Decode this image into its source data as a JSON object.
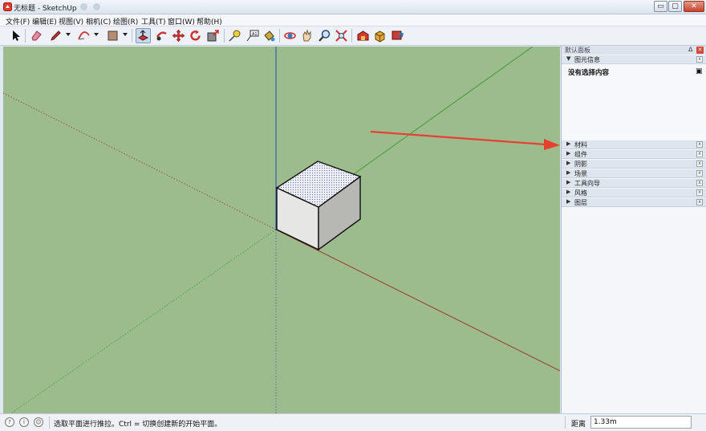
{
  "window": {
    "title": "无标题 - SketchUp",
    "minimize_glyph": "▭",
    "maximize_glyph": "▢",
    "close_glyph": "✕"
  },
  "menu": [
    "文件(F)",
    "编辑(E)",
    "视图(V)",
    "相机(C)",
    "绘图(R)",
    "工具(T)",
    "窗口(W)",
    "帮助(H)"
  ],
  "toolbar": {
    "tools": [
      "select-icon",
      "eraser-icon",
      "pencil-icon",
      "arc-icon",
      "rectangle-icon",
      "push-pull-icon",
      "follow-me-icon",
      "move-icon",
      "rotate-icon",
      "scale-icon",
      "tape-measure-icon",
      "text-icon",
      "paint-bucket-icon",
      "orbit-icon",
      "pan-icon",
      "zoom-icon",
      "zoom-extents-icon",
      "warehouse-icon",
      "components-icon",
      "share-icon"
    ],
    "active_tool": "push-pull-icon"
  },
  "tray": {
    "title": "默认面板",
    "pin_glyph": "ᐃ",
    "close_glyph": "✕",
    "entity_info": {
      "label": "图元信息",
      "content": "没有选择内容"
    },
    "panels": [
      "材料",
      "组件",
      "阴影",
      "场景",
      "工具向导",
      "风格",
      "图层"
    ],
    "panel_arrow": "▶",
    "open_arrow": "▼",
    "panel_close": "x"
  },
  "status": {
    "text": "选取平面进行推拉。Ctrl = 切换创建新的开始平面。",
    "measure_label": "距离",
    "measure_value": "1.33m"
  },
  "colors": {
    "viewport_bg": "#9dbc8d",
    "red_axis": "#9b3a2c",
    "green_axis": "#3d9a3a",
    "blue_axis": "#3241c8",
    "annotation_arrow": "#e8402f"
  }
}
